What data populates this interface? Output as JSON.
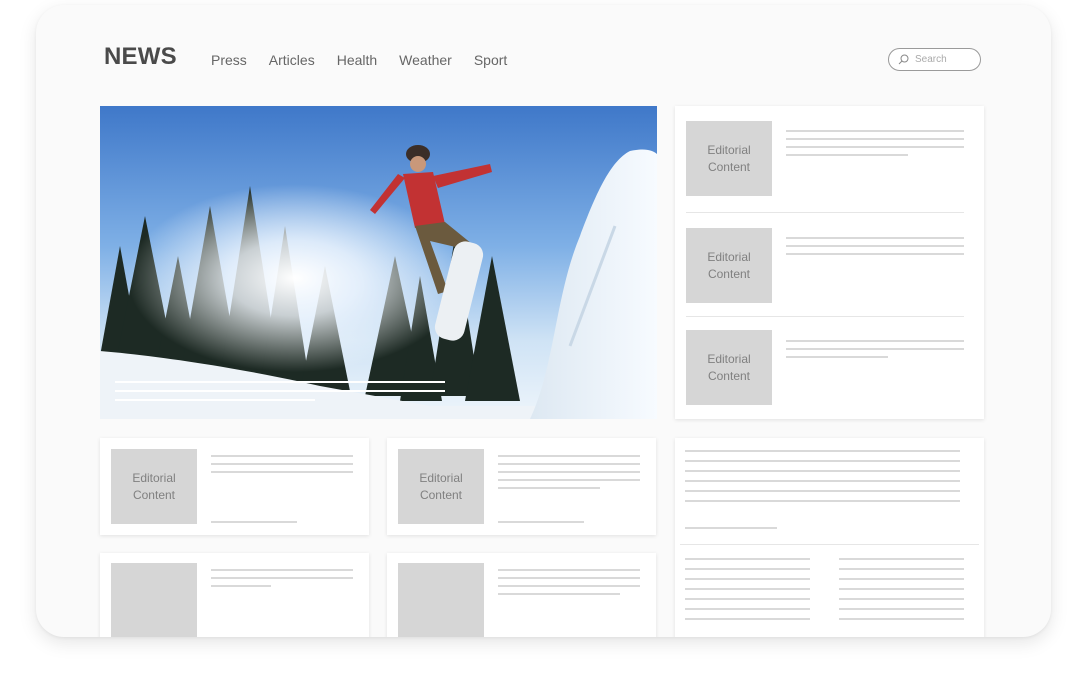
{
  "header": {
    "brand": "NEWS",
    "nav": [
      "Press",
      "Articles",
      "Health",
      "Weather",
      "Sport"
    ],
    "search_placeholder": "Search"
  },
  "hero": {
    "image": "snowboarder-jump-photo"
  },
  "side_list": {
    "items": [
      {
        "label": "Editorial\nContent"
      },
      {
        "label": "Editorial\nContent"
      },
      {
        "label": "Editorial\nContent"
      }
    ]
  },
  "grid": {
    "items": [
      {
        "label": "Editorial\nContent"
      },
      {
        "label": "Editorial\nContent"
      },
      {
        "label": ""
      },
      {
        "label": ""
      }
    ]
  },
  "colors": {
    "frame_bg": "#fafafa",
    "placeholder": "#d6d6d6",
    "text_line": "#d9d9d9"
  }
}
